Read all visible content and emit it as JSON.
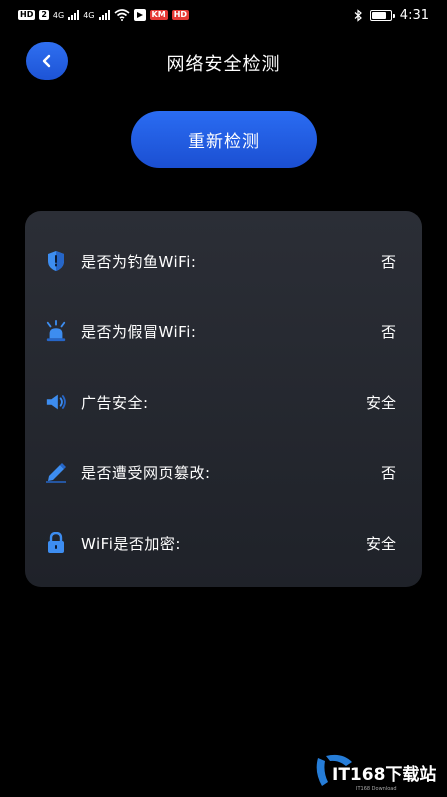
{
  "status_bar": {
    "left_chips": [
      "HD",
      "2"
    ],
    "network_labels": [
      "4G",
      "4G"
    ],
    "red_chips": [
      "KM",
      "HD"
    ],
    "time": "4:31"
  },
  "header": {
    "title": "网络安全检测"
  },
  "actions": {
    "redetect_label": "重新检测"
  },
  "results": [
    {
      "icon": "shield-icon",
      "label": "是否为钓鱼WiFi:",
      "value": "否"
    },
    {
      "icon": "alarm-icon",
      "label": "是否为假冒WiFi:",
      "value": "否"
    },
    {
      "icon": "speaker-icon",
      "label": "广告安全:",
      "value": "安全"
    },
    {
      "icon": "pencil-icon",
      "label": "是否遭受网页篡改:",
      "value": "否"
    },
    {
      "icon": "lock-icon",
      "label": "WiFi是否加密:",
      "value": "安全"
    }
  ],
  "watermark": {
    "brand": "IT168下载站",
    "sub": "IT168 Download"
  },
  "colors": {
    "background": "#000000",
    "accent": "#2a6cf2",
    "card": "#2b2e36",
    "text": "#ffffff"
  }
}
